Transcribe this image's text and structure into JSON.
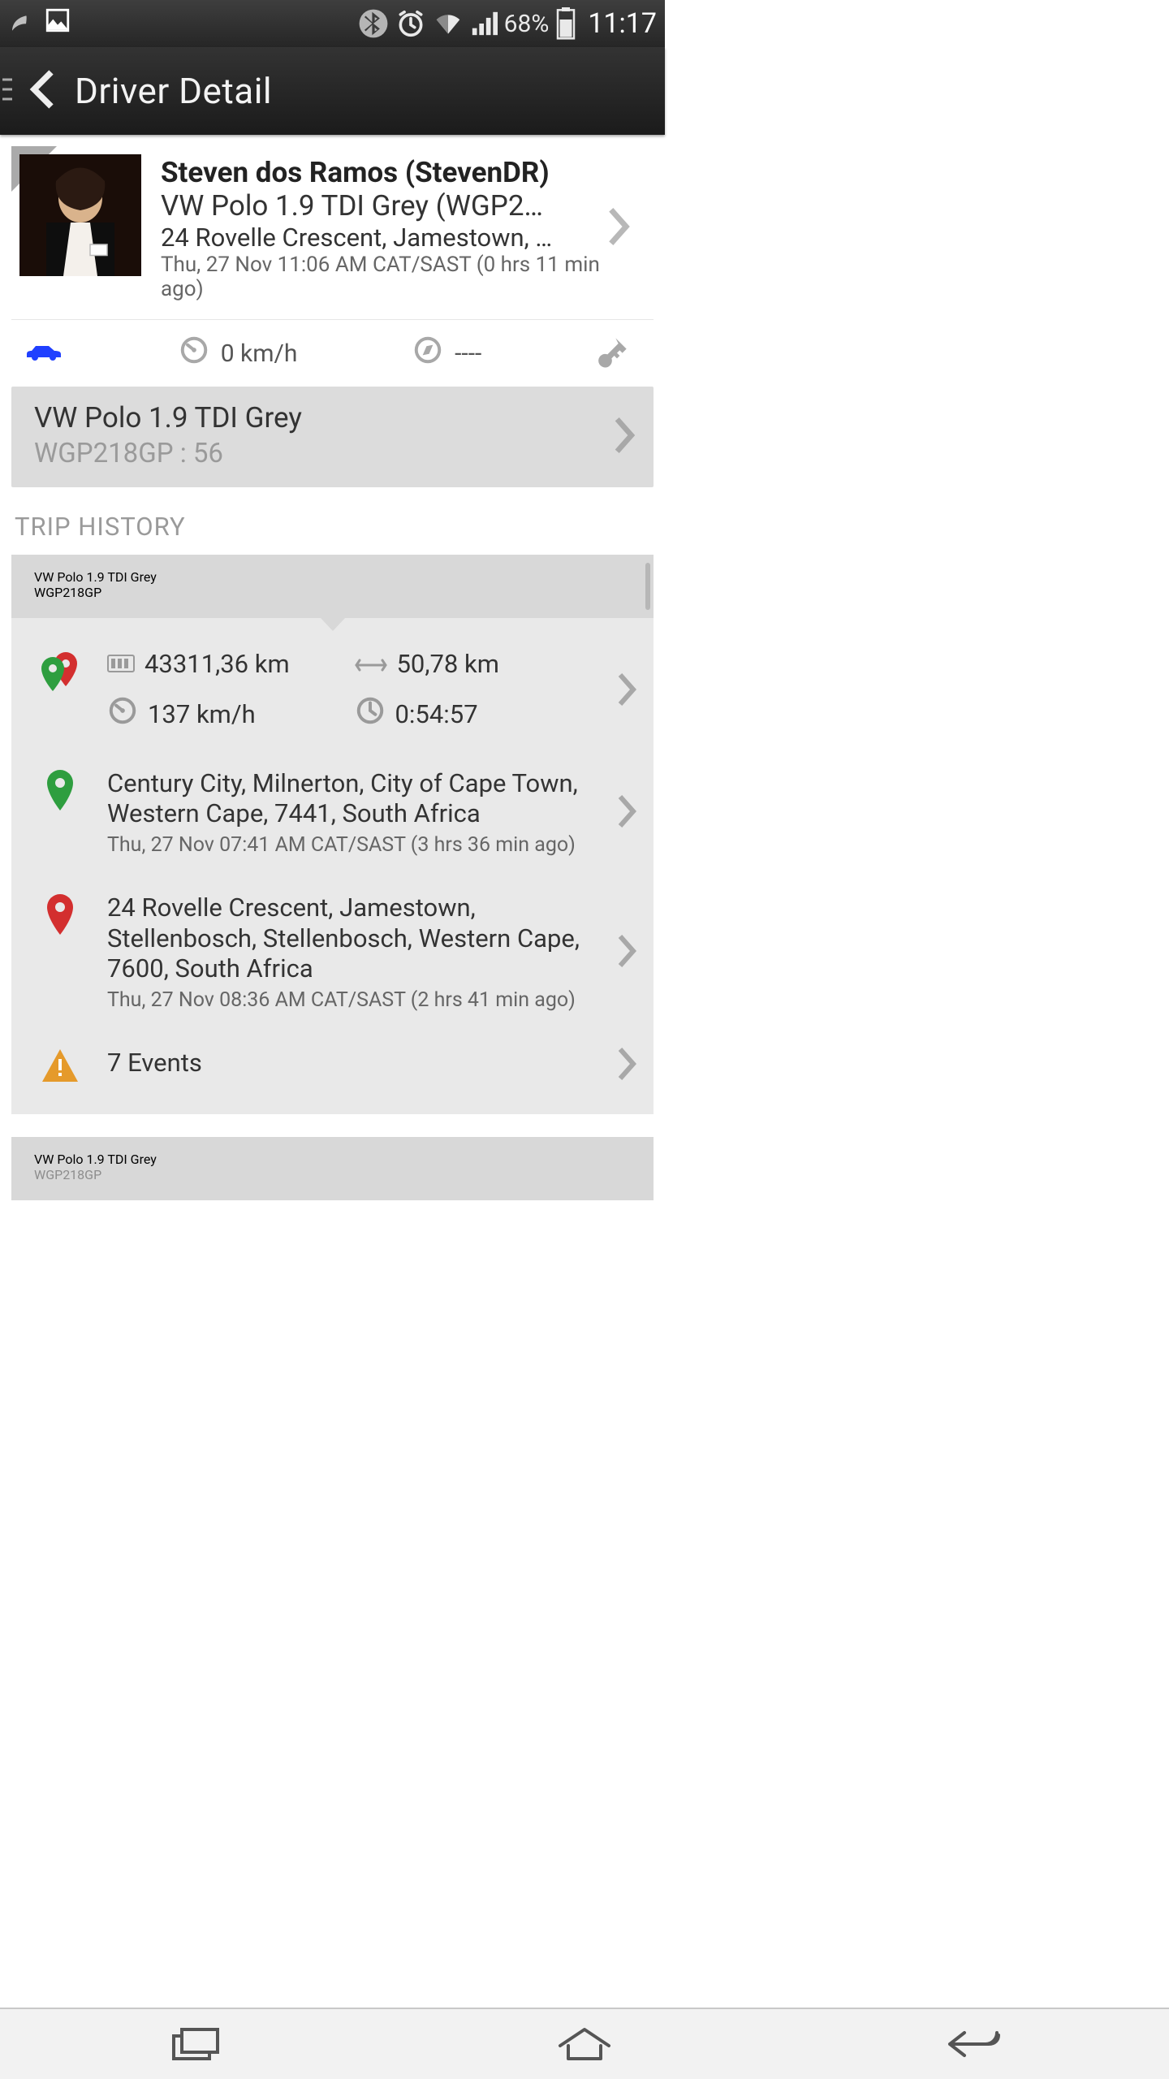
{
  "status_bar": {
    "battery_pct": "68%",
    "clock": "11:17"
  },
  "header": {
    "title": "Driver Detail"
  },
  "driver": {
    "name": "Steven dos Ramos (StevenDR)",
    "vehicle": "VW Polo 1.9 TDI Grey (WGP21…",
    "location": "24 Rovelle Crescent, Jamestown, Stelle…",
    "timestamp": "Thu, 27 Nov 11:06 AM CAT/SAST (0 hrs 11 min ago)"
  },
  "current_status": {
    "speed": "0 km/h",
    "heading": "----"
  },
  "vehicle_card": {
    "title": "VW Polo 1.9 TDI Grey",
    "subtitle": "WGP218GP : 56"
  },
  "sections": {
    "trip_history_label": "TRIP HISTORY"
  },
  "trip": {
    "vehicle_title": "VW Polo 1.9 TDI Grey",
    "vehicle_sub": "WGP218GP",
    "odometer": "43311,36 km",
    "distance": "50,78 km",
    "max_speed": "137 km/h",
    "duration": "0:54:57",
    "start": {
      "address": "Century City, Milnerton, City of Cape Town, Western Cape, 7441, South Africa",
      "time": "Thu, 27 Nov 07:41 AM CAT/SAST (3 hrs 36 min ago)"
    },
    "end": {
      "address": "24 Rovelle Crescent, Jamestown, Stellenbosch, Stellenbosch, Western Cape, 7600, South Africa",
      "time": "Thu, 27 Nov 08:36 AM CAT/SAST (2 hrs 41 min ago)"
    },
    "events": "7 Events"
  },
  "trip2": {
    "vehicle_title": "VW Polo 1.9 TDI Grey",
    "vehicle_sub": "WGP218GP"
  }
}
